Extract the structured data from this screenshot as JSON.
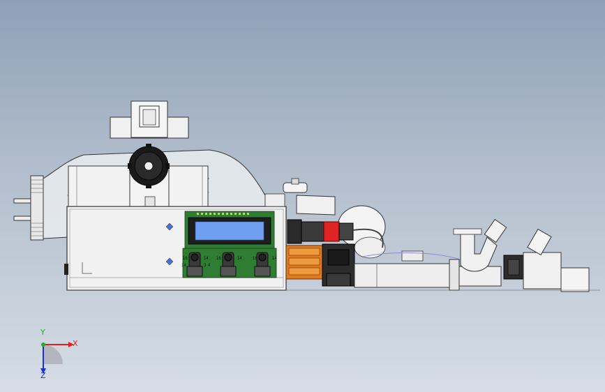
{
  "viewport": {
    "background_top": "#8fa0b7",
    "background_bottom": "#d6dde6",
    "model_name": "",
    "part_colors": {
      "housing": "#ededed",
      "edge": "#3a3a3a",
      "lcd_screen": "#6f9ff0",
      "lcd_bezel": "#1e1e1e",
      "pcb": "#2f7d32",
      "connector_orange": "#e07a1f",
      "ring_red": "#e02424",
      "mount_marker": "#4a6fcf"
    },
    "display_panel": {
      "knob_labels": [
        "16",
        "14",
        "16",
        "14",
        "16",
        "14"
      ],
      "small_labels": [
        "14",
        "3",
        "4"
      ]
    },
    "triad": {
      "x_label": "X",
      "y_label": "Y",
      "z_label": "Z",
      "x_color": "#e02020",
      "y_color": "#20b020",
      "z_color": "#2030d0"
    }
  }
}
